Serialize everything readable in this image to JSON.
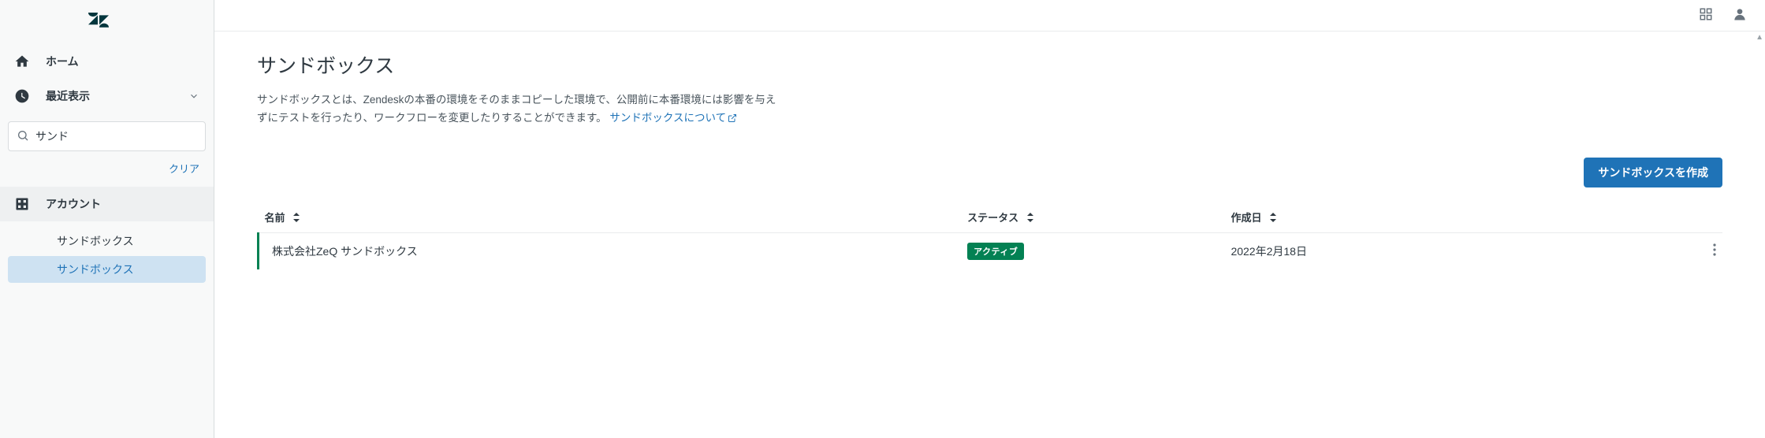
{
  "sidebar": {
    "home_label": "ホーム",
    "recent_label": "最近表示",
    "search_value": "サンド",
    "clear_label": "クリア",
    "section_label": "アカウント",
    "sub_items": [
      {
        "label": "サンドボックス",
        "active": false
      },
      {
        "label": "サンドボックス",
        "active": true
      }
    ]
  },
  "page": {
    "title": "サンドボックス",
    "description_prefix": "サンドボックスとは、Zendeskの本番の環境をそのままコピーした環境で、公開前に本番環境には影響を与えずにテストを行ったり、ワークフローを変更したりすることができます。",
    "link_text": "サンドボックスについて",
    "create_button": "サンドボックスを作成"
  },
  "table": {
    "columns": {
      "name": "名前",
      "status": "ステータス",
      "created": "作成日"
    },
    "rows": [
      {
        "name": "株式会社ZeQ サンドボックス",
        "status": "アクティブ",
        "created": "2022年2月18日"
      }
    ]
  }
}
